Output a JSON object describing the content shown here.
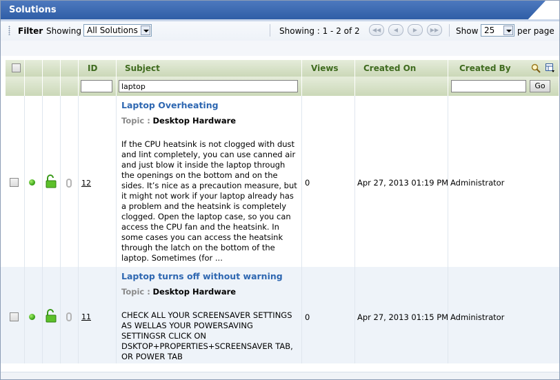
{
  "window": {
    "title": "Solutions"
  },
  "toolbar": {
    "filter_label": "Filter",
    "showing_label": "Showing",
    "filter_select_value": "All Solutions",
    "showing_range": "Showing : 1 - 2 of 2",
    "show_label": "Show",
    "per_page_value": "25",
    "per_page_label": "per page"
  },
  "table": {
    "columns": {
      "id": "ID",
      "subject": "Subject",
      "views": "Views",
      "created_on": "Created On",
      "created_by": "Created By"
    },
    "filters": {
      "subject_value": "laptop",
      "go_label": "Go"
    },
    "rows": [
      {
        "id": "12",
        "title": "Laptop Overheating",
        "topic_label": "Topic :",
        "topic": "Desktop Hardware",
        "body": "If the CPU heatsink is not clogged with dust and lint completely, you can use canned air and just blow it inside the laptop through the openings on the bottom and on the sides. It’s nice as a precaution measure, but it might not work if your laptop already has a problem and the heatsink is completely clogged. Open the laptop case, so you can access the CPU fan and the heatsink. In some cases you can access the heatsink through the latch on the bottom of the laptop. Sometimes (for ...",
        "views": "0",
        "created_on": "Apr 27, 2013 01:19 PM",
        "created_by": "Administrator"
      },
      {
        "id": "11",
        "title": "Laptop turns off without warning",
        "topic_label": "Topic :",
        "topic": "Desktop Hardware",
        "body": "CHECK ALL YOUR SCREENSAVER SETTINGS AS WELLAS YOUR POWERSAVING SETTINGSR CLICK ON DSKTOP+PROPERTIES+SCREENSAVER TAB, OR POWER TAB",
        "views": "0",
        "created_on": "Apr 27, 2013 01:15 PM",
        "created_by": "Administrator"
      }
    ]
  },
  "icons": {
    "status": "green-dot-icon",
    "lock": "unlocked-padlock-icon",
    "attachment": "paperclip-icon",
    "search": "magnifier-icon",
    "columns": "column-chooser-icon"
  },
  "colors": {
    "title_bar": "#3a68b0",
    "header_text": "#3f6b1f",
    "link": "#2e67b1",
    "alt_row": "#eef3f9"
  }
}
